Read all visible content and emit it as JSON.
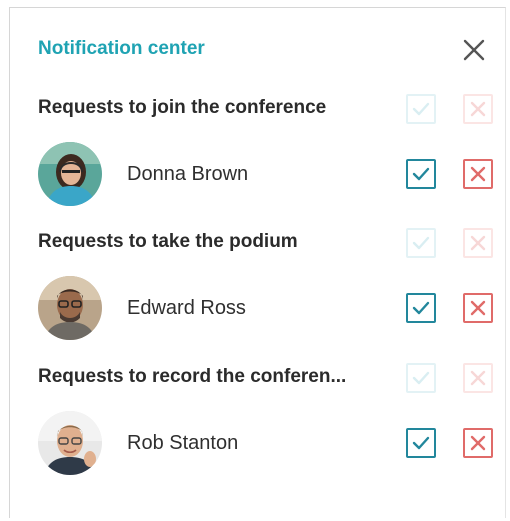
{
  "panel": {
    "title": "Notification center",
    "close_icon": "close-icon"
  },
  "sections": [
    {
      "title": "Requests to join the conference",
      "user": {
        "name": "Donna Brown"
      }
    },
    {
      "title": "Requests to take the podium",
      "user": {
        "name": "Edward Ross"
      }
    },
    {
      "title": "Requests to record the conferen...",
      "user": {
        "name": "Rob Stanton"
      }
    }
  ],
  "colors": {
    "title": "#1fa3b3",
    "accept": "#22879c",
    "reject": "#e06b69",
    "accept_faded": "#e3f2f5",
    "reject_faded": "#fbe5e4"
  },
  "icons": {
    "accept": "check-icon",
    "reject": "x-icon"
  }
}
